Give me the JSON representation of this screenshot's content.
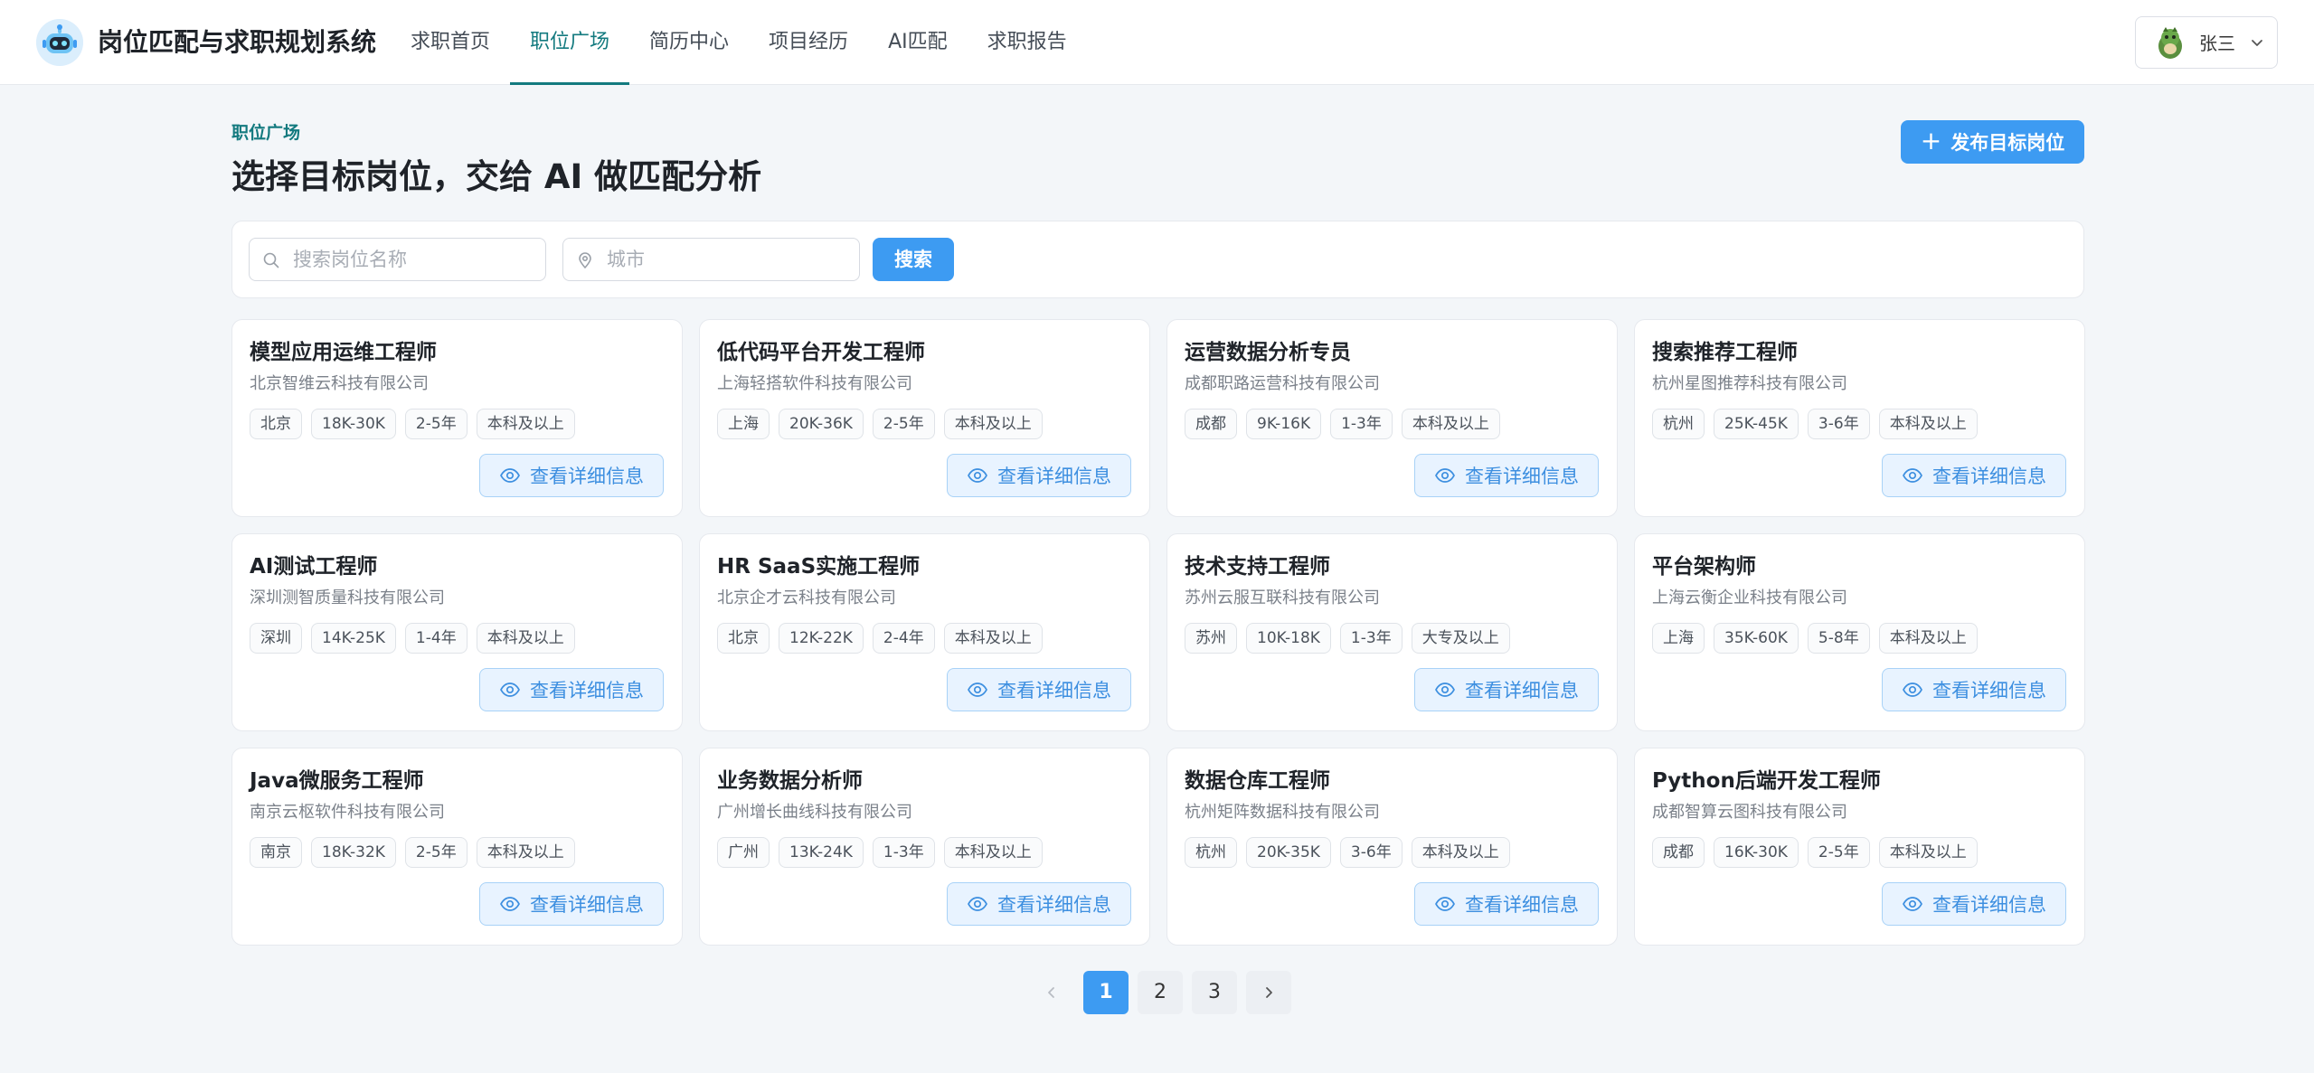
{
  "header": {
    "app_title": "岗位匹配与求职规划系统",
    "nav": [
      {
        "label": "求职首页",
        "active": false
      },
      {
        "label": "职位广场",
        "active": true
      },
      {
        "label": "简历中心",
        "active": false
      },
      {
        "label": "项目经历",
        "active": false
      },
      {
        "label": "AI匹配",
        "active": false
      },
      {
        "label": "求职报告",
        "active": false
      }
    ],
    "user": {
      "name": "张三",
      "avatar_icon": "avatar-icon"
    }
  },
  "page": {
    "eyebrow": "职位广场",
    "title": "选择目标岗位，交给 AI 做匹配分析",
    "publish_label": "发布目标岗位"
  },
  "search": {
    "keyword_placeholder": "搜索岗位名称",
    "city_placeholder": "城市",
    "button_label": "搜索"
  },
  "jobs": [
    {
      "title": "模型应用运维工程师",
      "company": "北京智维云科技有限公司",
      "tags": [
        "北京",
        "18K-30K",
        "2-5年",
        "本科及以上"
      ]
    },
    {
      "title": "低代码平台开发工程师",
      "company": "上海轻搭软件科技有限公司",
      "tags": [
        "上海",
        "20K-36K",
        "2-5年",
        "本科及以上"
      ]
    },
    {
      "title": "运营数据分析专员",
      "company": "成都职路运营科技有限公司",
      "tags": [
        "成都",
        "9K-16K",
        "1-3年",
        "本科及以上"
      ]
    },
    {
      "title": "搜索推荐工程师",
      "company": "杭州星图推荐科技有限公司",
      "tags": [
        "杭州",
        "25K-45K",
        "3-6年",
        "本科及以上"
      ]
    },
    {
      "title": "AI测试工程师",
      "company": "深圳测智质量科技有限公司",
      "tags": [
        "深圳",
        "14K-25K",
        "1-4年",
        "本科及以上"
      ]
    },
    {
      "title": "HR SaaS实施工程师",
      "company": "北京企才云科技有限公司",
      "tags": [
        "北京",
        "12K-22K",
        "2-4年",
        "本科及以上"
      ]
    },
    {
      "title": "技术支持工程师",
      "company": "苏州云服互联科技有限公司",
      "tags": [
        "苏州",
        "10K-18K",
        "1-3年",
        "大专及以上"
      ]
    },
    {
      "title": "平台架构师",
      "company": "上海云衡企业科技有限公司",
      "tags": [
        "上海",
        "35K-60K",
        "5-8年",
        "本科及以上"
      ]
    },
    {
      "title": "Java微服务工程师",
      "company": "南京云枢软件科技有限公司",
      "tags": [
        "南京",
        "18K-32K",
        "2-5年",
        "本科及以上"
      ]
    },
    {
      "title": "业务数据分析师",
      "company": "广州增长曲线科技有限公司",
      "tags": [
        "广州",
        "13K-24K",
        "1-3年",
        "本科及以上"
      ]
    },
    {
      "title": "数据仓库工程师",
      "company": "杭州矩阵数据科技有限公司",
      "tags": [
        "杭州",
        "20K-35K",
        "3-6年",
        "本科及以上"
      ]
    },
    {
      "title": "Python后端开发工程师",
      "company": "成都智算云图科技有限公司",
      "tags": [
        "成都",
        "16K-30K",
        "2-5年",
        "本科及以上"
      ]
    }
  ],
  "detail_label": "查看详细信息",
  "pagination": {
    "pages": [
      "1",
      "2",
      "3"
    ],
    "current": "1"
  },
  "colors": {
    "accent": "#3d9bf2",
    "nav_active": "#137a7f",
    "background": "#f3f6f9"
  }
}
